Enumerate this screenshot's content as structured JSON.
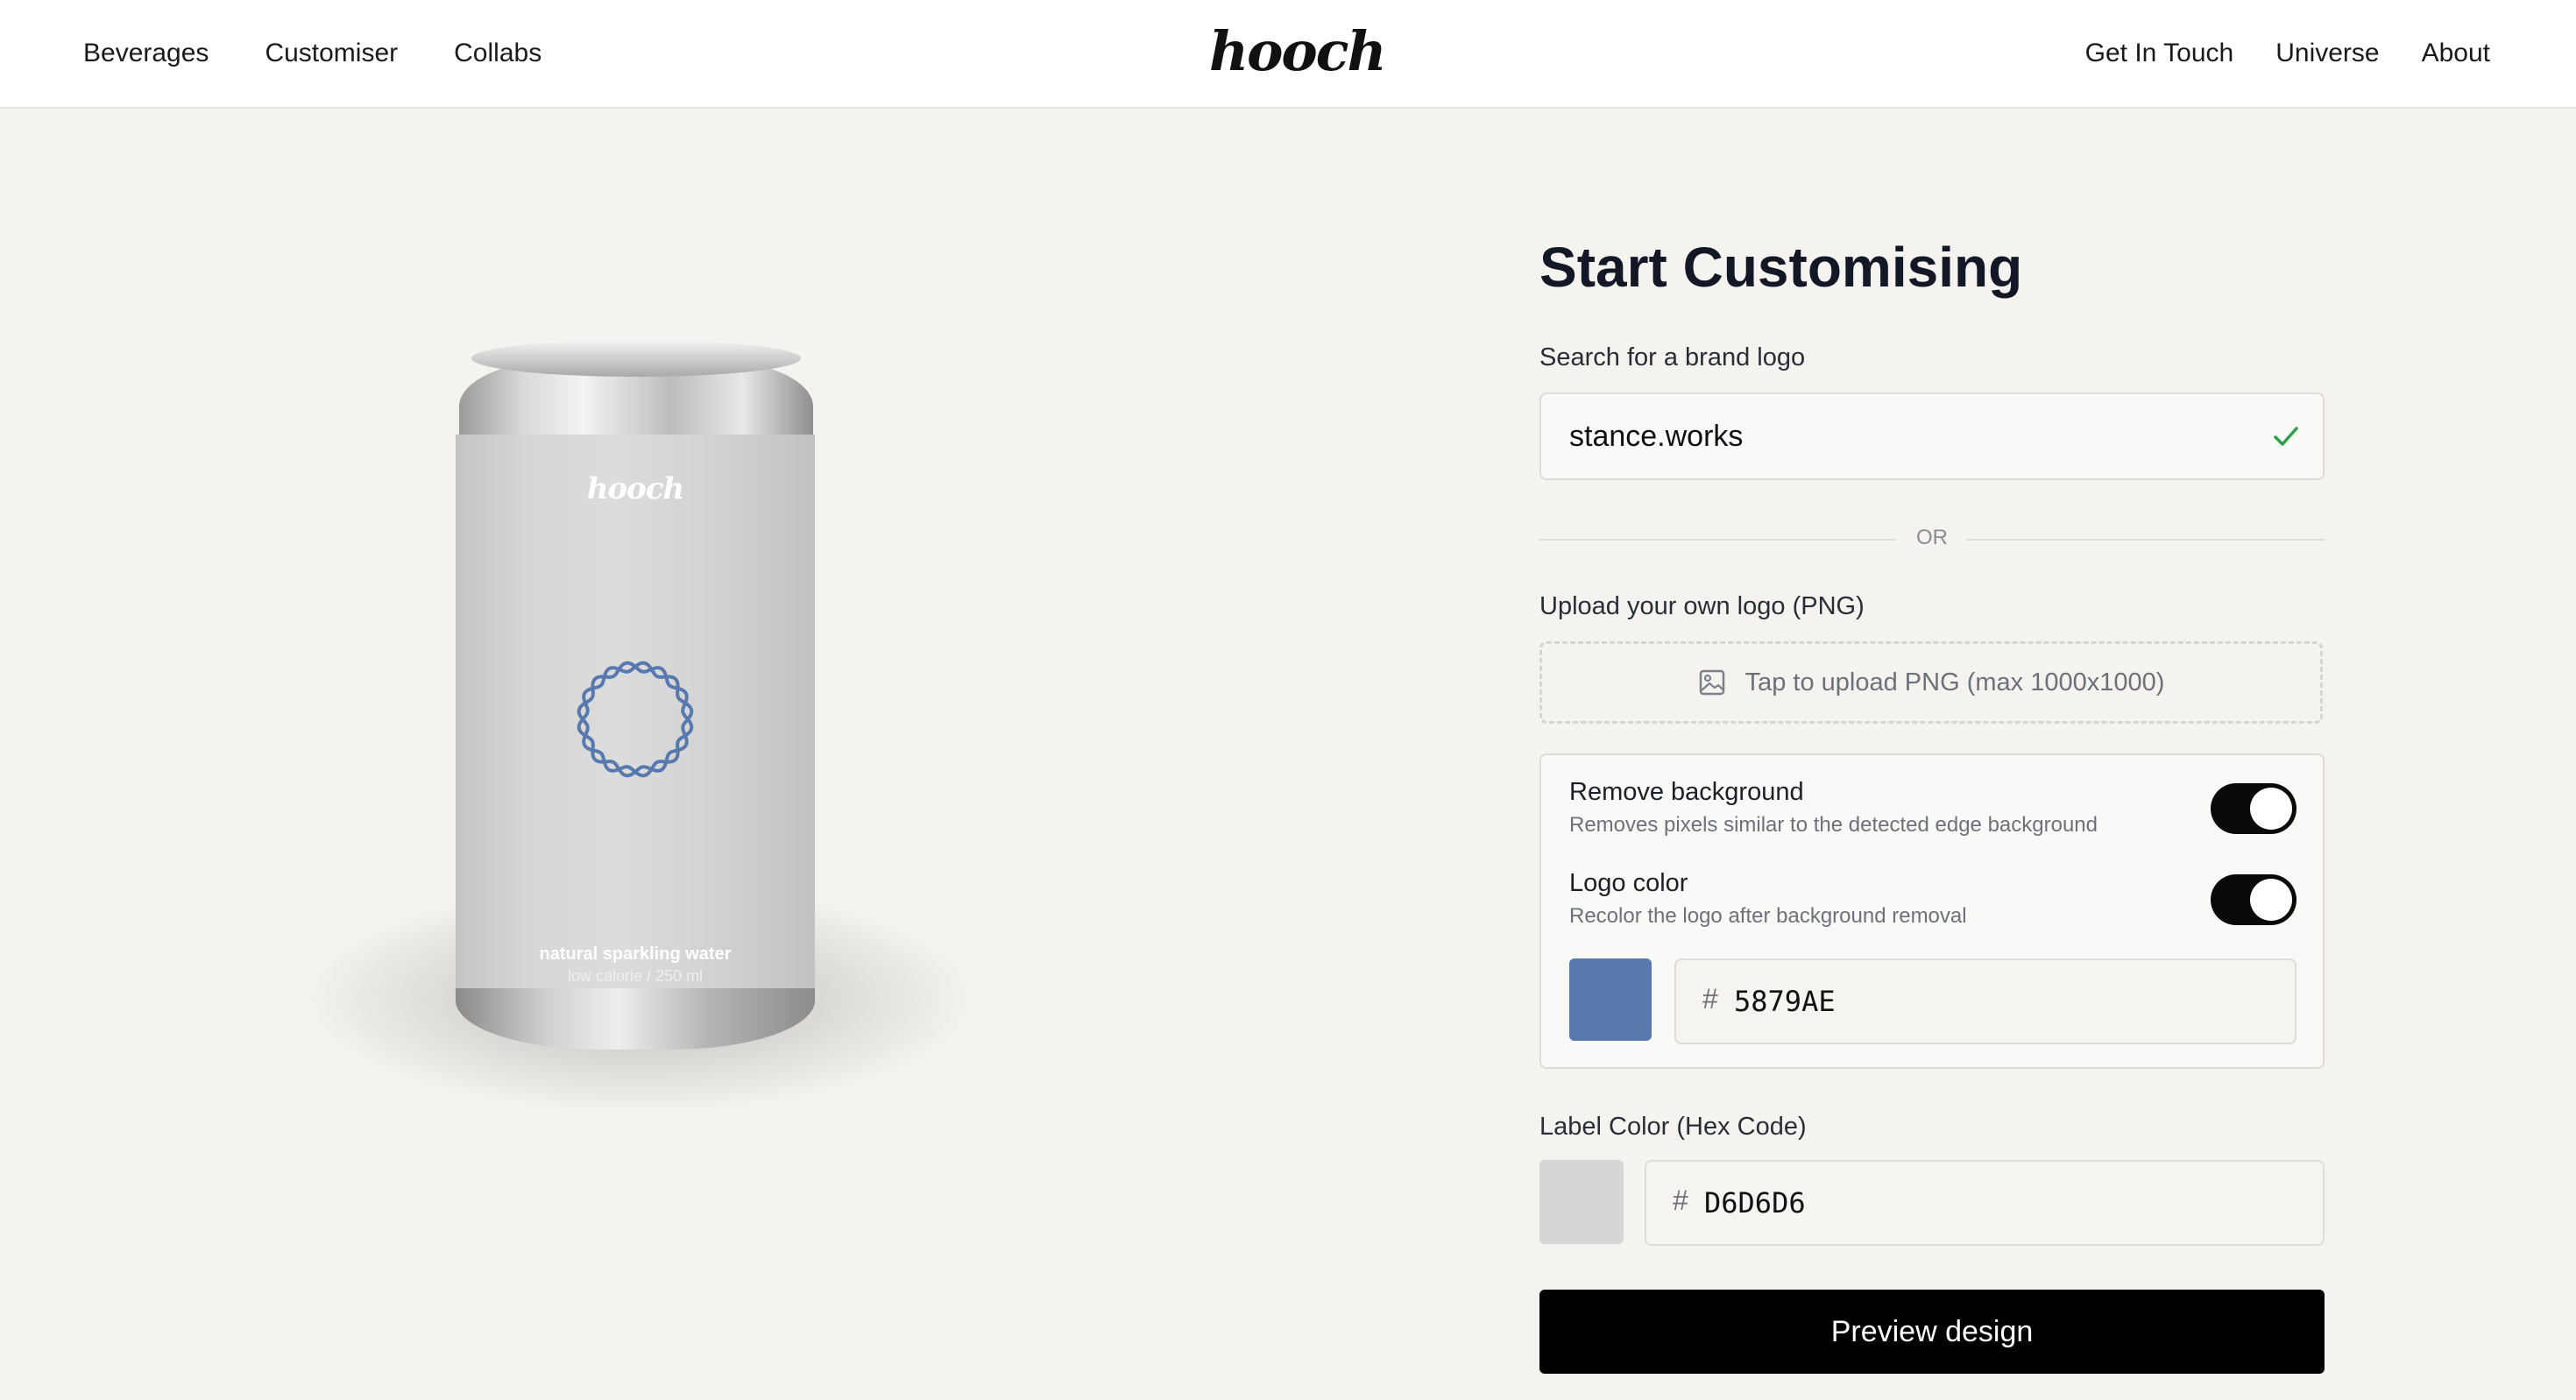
{
  "nav": {
    "left": [
      "Beverages",
      "Customiser",
      "Collabs"
    ],
    "right": [
      "Get In Touch",
      "Universe",
      "About"
    ],
    "logo": "hooch"
  },
  "can": {
    "brand": "hooch",
    "tagline": "natural sparkling water",
    "subtag": "low calorie / 250 ml",
    "label_color": "#D6D6D6",
    "logo_color": "#5879AE"
  },
  "form": {
    "title": "Start Customising",
    "search_label": "Search for a brand logo",
    "search_value": "stance.works",
    "or_text": "OR",
    "upload_label": "Upload your own logo (PNG)",
    "upload_text": "Tap to upload PNG (max 1000x1000)",
    "remove_bg_title": "Remove background",
    "remove_bg_sub": "Removes pixels similar to the detected edge background",
    "remove_bg_on": true,
    "logo_color_title": "Logo color",
    "logo_color_sub": "Recolor the logo after background removal",
    "logo_color_on": true,
    "logo_hex": "5879AE",
    "logo_hex_color": "#5879AE",
    "label_color_label": "Label Color (Hex Code)",
    "label_hex": "D6D6D6",
    "label_hex_color": "#D6D6D6",
    "hash": "#",
    "preview_button": "Preview design"
  },
  "icons": {
    "search_valid": "check-icon",
    "upload": "image-icon"
  }
}
